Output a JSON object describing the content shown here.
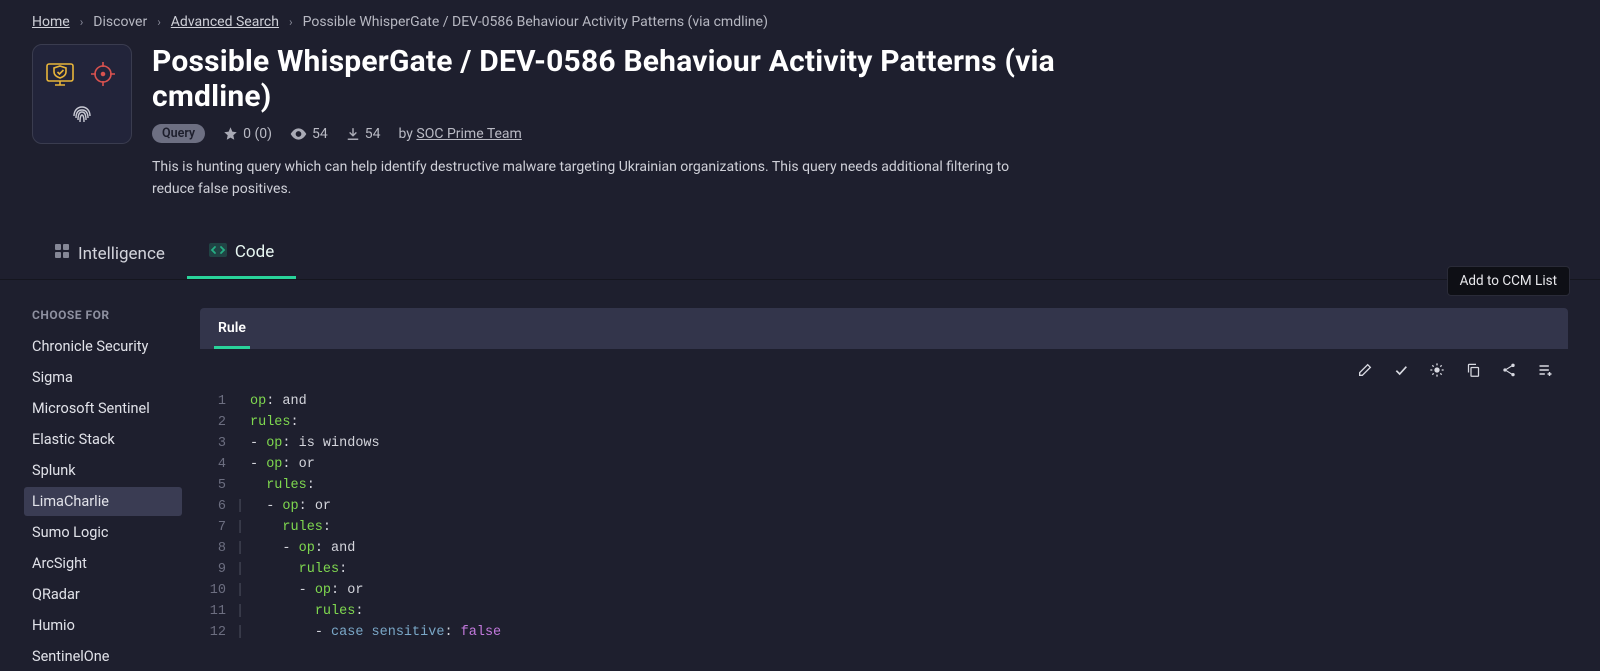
{
  "breadcrumb": {
    "items": [
      {
        "label": "Home",
        "link": true
      },
      {
        "label": "Discover",
        "link": false
      },
      {
        "label": "Advanced Search",
        "link": true
      },
      {
        "label": "Possible WhisperGate / DEV-0586 Behaviour Activity Patterns (via cmdline)",
        "link": false
      }
    ]
  },
  "header": {
    "title": "Possible WhisperGate / DEV-0586 Behaviour Activity Patterns (via cmdline)",
    "badge": "Query",
    "rating": "0 (0)",
    "views": "54",
    "downloads": "54",
    "by_prefix": "by",
    "author": "SOC Prime Team",
    "description": "This is hunting query which can help identify destructive malware targeting Ukrainian organizations. This query needs additional filtering to reduce false positives."
  },
  "tabs": {
    "intelligence": "Intelligence",
    "code": "Code"
  },
  "sidebar": {
    "title": "CHOOSE FOR",
    "platforms": [
      "Chronicle Security",
      "Sigma",
      "Microsoft Sentinel",
      "Elastic Stack",
      "Splunk",
      "LimaCharlie",
      "Sumo Logic",
      "ArcSight",
      "QRadar",
      "Humio",
      "SentinelOne"
    ],
    "selected": "LimaCharlie"
  },
  "codepanel": {
    "rule_tab": "Rule",
    "tooltip": "Add to CCM List"
  },
  "code_lines": [
    {
      "n": 1,
      "gutter": "",
      "segs": [
        [
          "key",
          "op"
        ],
        [
          "punc",
          ": "
        ],
        [
          "plain",
          "and"
        ]
      ]
    },
    {
      "n": 2,
      "gutter": "",
      "segs": [
        [
          "key",
          "rules"
        ],
        [
          "punc",
          ":"
        ]
      ]
    },
    {
      "n": 3,
      "gutter": "",
      "segs": [
        [
          "punc",
          "- "
        ],
        [
          "key",
          "op"
        ],
        [
          "punc",
          ": "
        ],
        [
          "plain",
          "is windows"
        ]
      ]
    },
    {
      "n": 4,
      "gutter": "",
      "segs": [
        [
          "punc",
          "- "
        ],
        [
          "key",
          "op"
        ],
        [
          "punc",
          ": "
        ],
        [
          "plain",
          "or"
        ]
      ]
    },
    {
      "n": 5,
      "gutter": "",
      "segs": [
        [
          "plain",
          "  "
        ],
        [
          "key",
          "rules"
        ],
        [
          "punc",
          ":"
        ]
      ]
    },
    {
      "n": 6,
      "gutter": "|",
      "segs": [
        [
          "plain",
          "  "
        ],
        [
          "punc",
          "- "
        ],
        [
          "key",
          "op"
        ],
        [
          "punc",
          ": "
        ],
        [
          "plain",
          "or"
        ]
      ]
    },
    {
      "n": 7,
      "gutter": "|",
      "segs": [
        [
          "plain",
          "    "
        ],
        [
          "key",
          "rules"
        ],
        [
          "punc",
          ":"
        ]
      ]
    },
    {
      "n": 8,
      "gutter": "|",
      "segs": [
        [
          "plain",
          "    "
        ],
        [
          "punc",
          "- "
        ],
        [
          "key",
          "op"
        ],
        [
          "punc",
          ": "
        ],
        [
          "plain",
          "and"
        ]
      ]
    },
    {
      "n": 9,
      "gutter": "|",
      "segs": [
        [
          "plain",
          "      "
        ],
        [
          "key",
          "rules"
        ],
        [
          "punc",
          ":"
        ]
      ]
    },
    {
      "n": 10,
      "gutter": "|",
      "segs": [
        [
          "plain",
          "      "
        ],
        [
          "punc",
          "- "
        ],
        [
          "key",
          "op"
        ],
        [
          "punc",
          ": "
        ],
        [
          "plain",
          "or"
        ]
      ]
    },
    {
      "n": 11,
      "gutter": "|",
      "segs": [
        [
          "plain",
          "        "
        ],
        [
          "key",
          "rules"
        ],
        [
          "punc",
          ":"
        ]
      ]
    },
    {
      "n": 12,
      "gutter": "|",
      "segs": [
        [
          "plain",
          "        "
        ],
        [
          "punc",
          "- "
        ],
        [
          "attr",
          "case sensitive"
        ],
        [
          "punc",
          ": "
        ],
        [
          "bool",
          "false"
        ]
      ]
    }
  ]
}
